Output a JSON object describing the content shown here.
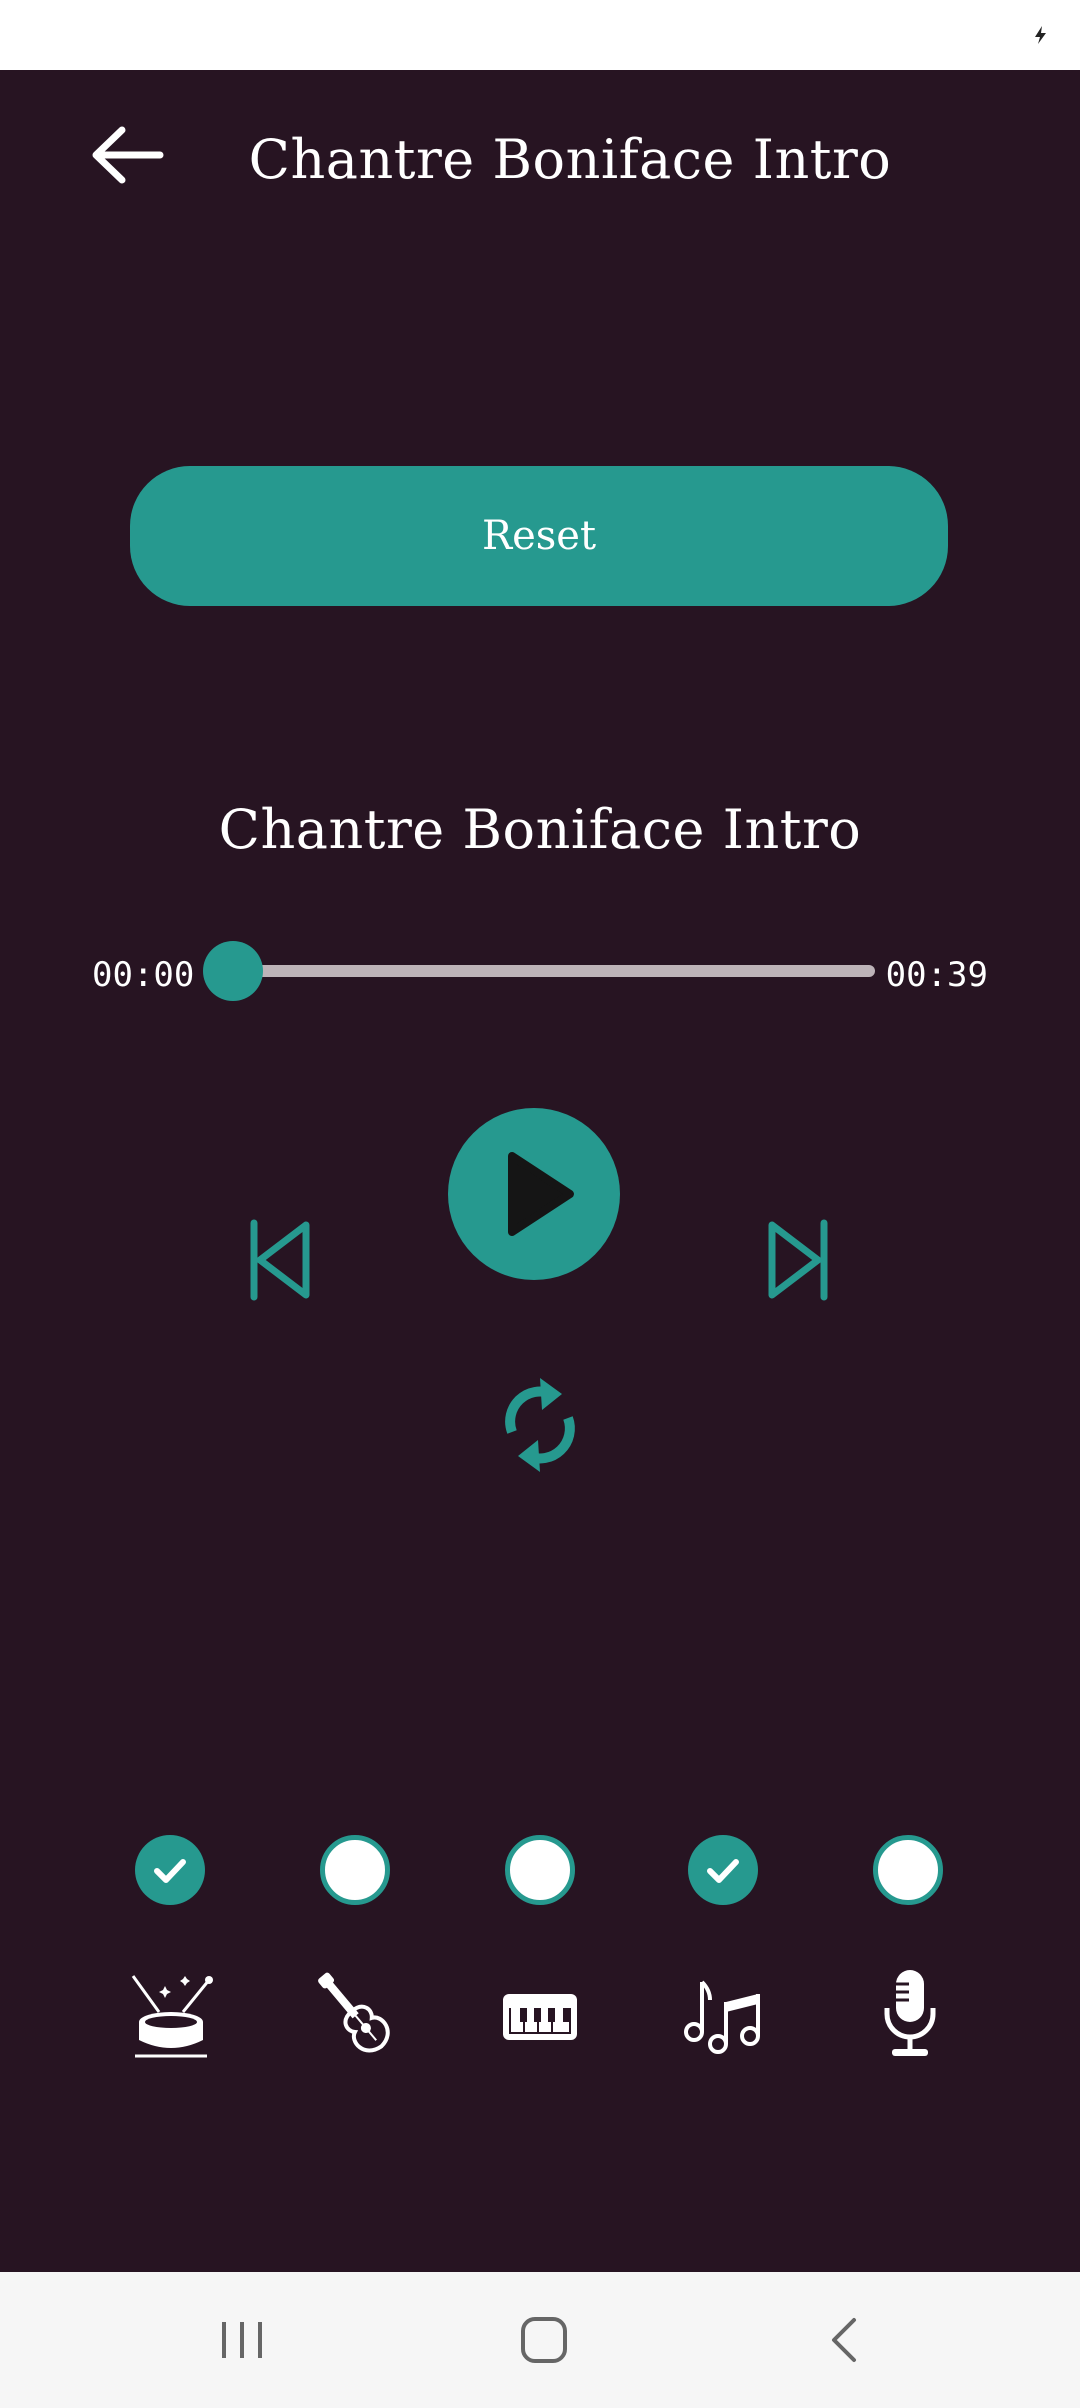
{
  "header": {
    "title": "Chantre Boniface Intro"
  },
  "reset_button": {
    "label": "Reset"
  },
  "player": {
    "track_title": "Chantre Boniface Intro",
    "current_time": "00:00",
    "total_time": "00:39",
    "progress": 0
  },
  "instruments": [
    {
      "icon": "drum-icon",
      "selected": true
    },
    {
      "icon": "guitar-icon",
      "selected": false
    },
    {
      "icon": "piano-icon",
      "selected": false
    },
    {
      "icon": "music-notes-icon",
      "selected": true
    },
    {
      "icon": "microphone-icon",
      "selected": false
    }
  ],
  "colors": {
    "background": "#271422",
    "accent": "#26998f",
    "text": "#ffffff"
  }
}
